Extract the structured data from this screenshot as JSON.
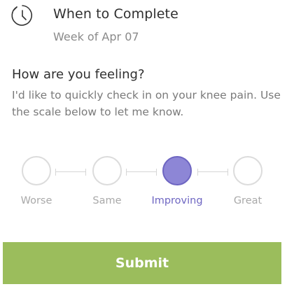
{
  "header": {
    "icon": "clock-icon",
    "title": "When to Complete",
    "subtitle": "Week of Apr 07"
  },
  "question": {
    "title": "How are you feeling?",
    "description": "I'd like to quickly check in on your knee pain. Use the scale below to let me know."
  },
  "scale": {
    "options": [
      "Worse",
      "Same",
      "Improving",
      "Great"
    ],
    "selected": "Improving"
  },
  "submit": {
    "label": "Submit"
  },
  "colors": {
    "accent": "#8d86d6",
    "accent_text": "#6e66c2",
    "submit_bg": "#9bbd5c",
    "muted_text": "#a9a9a9"
  }
}
